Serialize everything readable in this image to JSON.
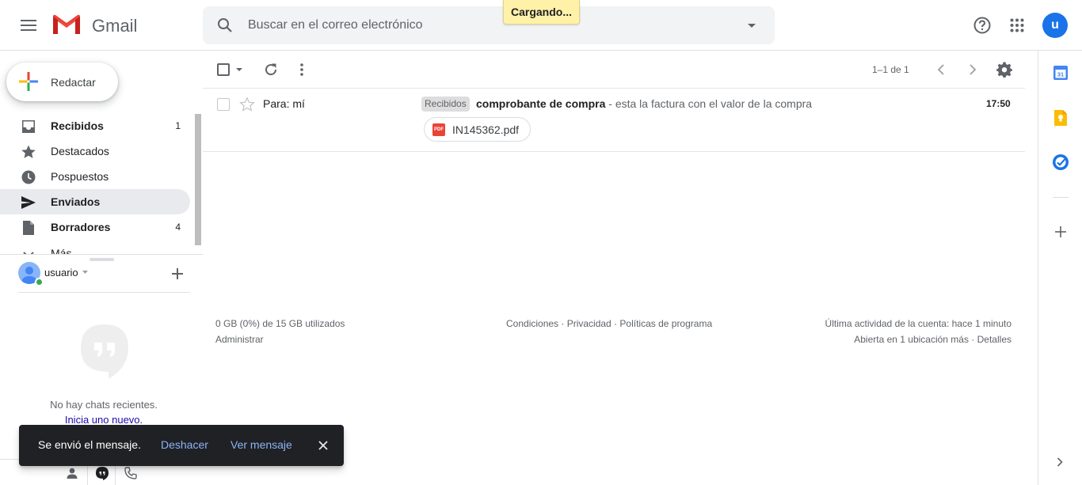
{
  "app": {
    "name": "Gmail"
  },
  "header": {
    "search_placeholder": "Buscar en el correo electrónico",
    "loading_text": "Cargando...",
    "avatar_letter": "u",
    "avatar_color": "#1a73e8"
  },
  "compose": {
    "label": "Redactar"
  },
  "nav": [
    {
      "label": "Recibidos",
      "count": "1",
      "icon": "inbox-icon",
      "bold": true
    },
    {
      "label": "Destacados",
      "count": "",
      "icon": "star-icon",
      "bold": false
    },
    {
      "label": "Pospuestos",
      "count": "",
      "icon": "clock-icon",
      "bold": false
    },
    {
      "label": "Enviados",
      "count": "",
      "icon": "send-icon",
      "bold": true,
      "active": true
    },
    {
      "label": "Borradores",
      "count": "4",
      "icon": "draft-icon",
      "bold": true
    },
    {
      "label": "Más",
      "count": "",
      "icon": "chevron-down-icon",
      "bold": false
    }
  ],
  "hangouts": {
    "user": "usuario",
    "no_chats": "No hay chats recientes.",
    "start_new": "Inicia uno nuevo."
  },
  "toolbar": {
    "pagination": "1–1 de 1"
  },
  "messages": [
    {
      "recipient": "Para: mí",
      "label": "Recibidos",
      "subject": "comprobante de compra",
      "snippet": " - esta la factura con el valor de la compra",
      "time": "17:50",
      "attachment": {
        "name": "IN145362.pdf",
        "type": "PDF"
      }
    }
  ],
  "footer": {
    "storage": "0 GB (0%) de 15 GB utilizados",
    "manage": "Administrar",
    "terms": "Condiciones · Privacidad · Políticas de programa",
    "last_activity": "Última actividad de la cuenta: hace 1 minuto",
    "open_location": "Abierta en 1 ubicación más · Detalles"
  },
  "snackbar": {
    "message": "Se envió el mensaje.",
    "undo": "Deshacer",
    "view": "Ver mensaje"
  },
  "colors": {
    "accent_blue": "#1a73e8",
    "link_blue": "#1a0dab",
    "snackbar_link": "#8ab4f8",
    "loading_bg": "#fff1a8",
    "online_green": "#34a853"
  }
}
